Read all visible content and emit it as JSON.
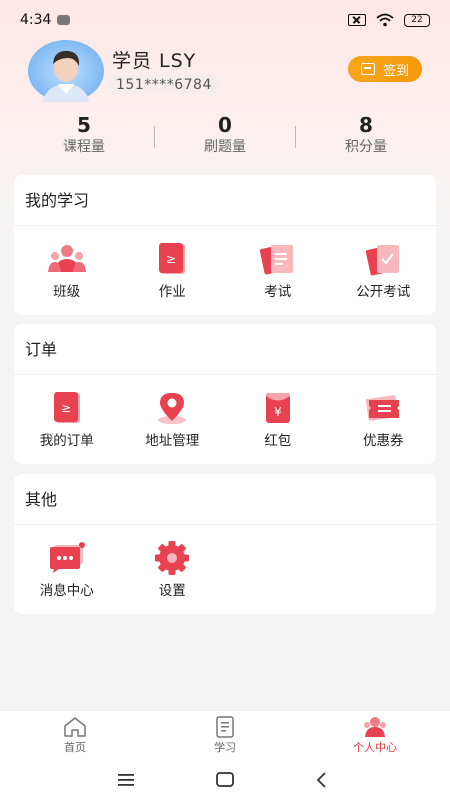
{
  "status_bar": {
    "time": "4:34",
    "battery": "22"
  },
  "profile": {
    "name": "学员 LSY",
    "phone": "151****6784",
    "signin_label": "签到"
  },
  "stats": [
    {
      "value": "5",
      "label": "课程量"
    },
    {
      "value": "0",
      "label": "刷题量"
    },
    {
      "value": "8",
      "label": "积分量"
    }
  ],
  "study": {
    "title": "我的学习",
    "items": [
      {
        "label": "班级",
        "icon": "class-icon"
      },
      {
        "label": "作业",
        "icon": "homework-icon"
      },
      {
        "label": "考试",
        "icon": "exam-icon"
      },
      {
        "label": "公开考试",
        "icon": "public-exam-icon"
      }
    ]
  },
  "orders": {
    "title": "订单",
    "items": [
      {
        "label": "我的订单",
        "icon": "order-icon"
      },
      {
        "label": "地址管理",
        "icon": "location-pin-icon"
      },
      {
        "label": "红包",
        "icon": "red-packet-icon"
      },
      {
        "label": "优惠券",
        "icon": "coupon-icon"
      }
    ]
  },
  "other": {
    "title": "其他",
    "items": [
      {
        "label": "消息中心",
        "icon": "message-icon"
      },
      {
        "label": "设置",
        "icon": "settings-gear-icon"
      }
    ]
  },
  "tabbar": {
    "items": [
      {
        "label": "首页",
        "icon": "home-icon",
        "active": false
      },
      {
        "label": "学习",
        "icon": "study-doc-icon",
        "active": false
      },
      {
        "label": "个人中心",
        "icon": "profile-icon",
        "active": true
      }
    ]
  },
  "colors": {
    "accent": "#e33a45",
    "signin": "#f7a015",
    "icon_red": "#e8414f"
  }
}
